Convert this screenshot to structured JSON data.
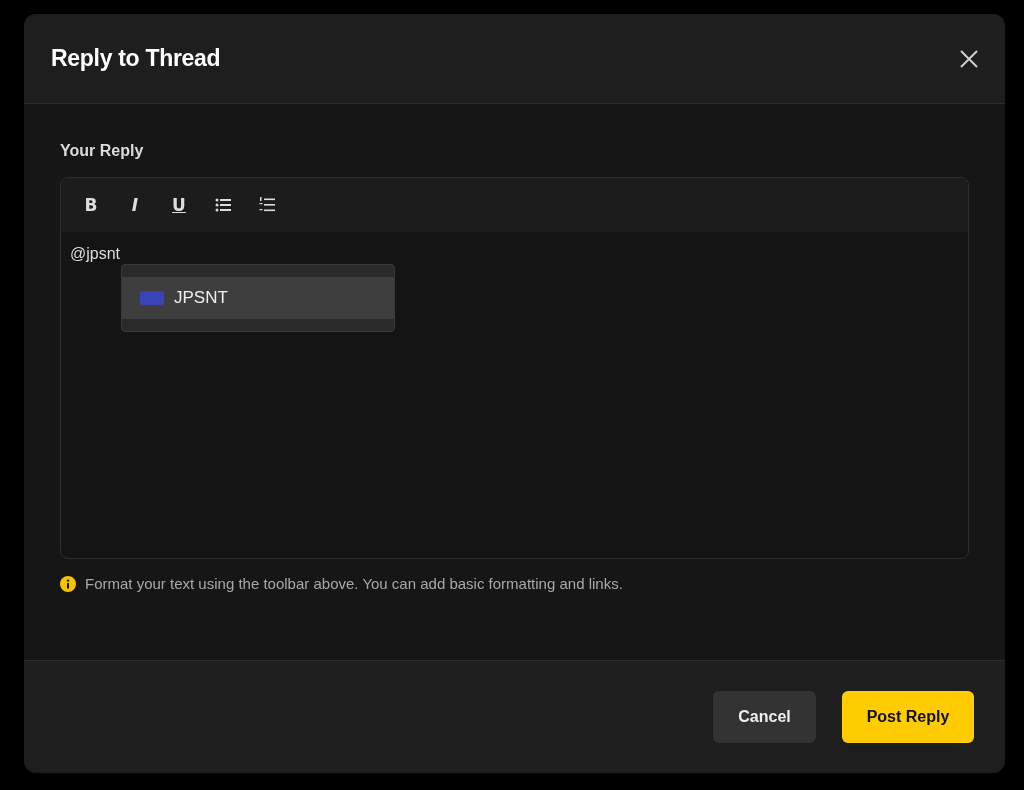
{
  "dialog": {
    "title": "Reply to Thread"
  },
  "field": {
    "label": "Your Reply",
    "value": "@jpsnt"
  },
  "toolbar": [
    {
      "kind": "bold",
      "label": "B"
    },
    {
      "kind": "italic",
      "label": "I"
    },
    {
      "kind": "underline",
      "label": "U"
    },
    {
      "kind": "bullet-list"
    },
    {
      "kind": "numbered-list"
    }
  ],
  "mention_menu": [
    {
      "name": "JPSNT",
      "selected": true
    }
  ],
  "hint": "Format your text using the toolbar above. You can add basic formatting and links.",
  "buttons": [
    {
      "kind": "secondary",
      "label": "Cancel"
    },
    {
      "kind": "primary",
      "label": "Post Reply"
    }
  ]
}
